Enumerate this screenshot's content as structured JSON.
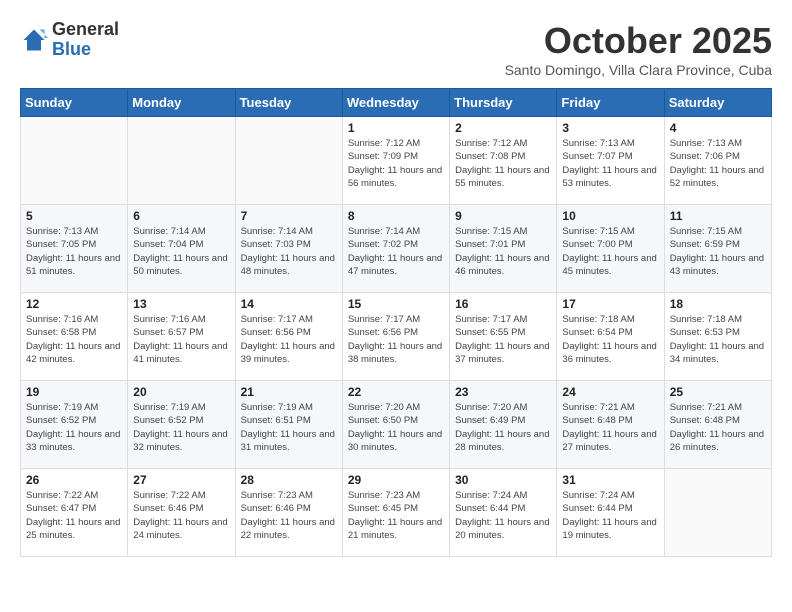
{
  "logo": {
    "general": "General",
    "blue": "Blue"
  },
  "title": {
    "month_year": "October 2025",
    "location": "Santo Domingo, Villa Clara Province, Cuba"
  },
  "days_of_week": [
    "Sunday",
    "Monday",
    "Tuesday",
    "Wednesday",
    "Thursday",
    "Friday",
    "Saturday"
  ],
  "weeks": [
    [
      {
        "day": "",
        "info": ""
      },
      {
        "day": "",
        "info": ""
      },
      {
        "day": "",
        "info": ""
      },
      {
        "day": "1",
        "info": "Sunrise: 7:12 AM\nSunset: 7:09 PM\nDaylight: 11 hours and 56 minutes."
      },
      {
        "day": "2",
        "info": "Sunrise: 7:12 AM\nSunset: 7:08 PM\nDaylight: 11 hours and 55 minutes."
      },
      {
        "day": "3",
        "info": "Sunrise: 7:13 AM\nSunset: 7:07 PM\nDaylight: 11 hours and 53 minutes."
      },
      {
        "day": "4",
        "info": "Sunrise: 7:13 AM\nSunset: 7:06 PM\nDaylight: 11 hours and 52 minutes."
      }
    ],
    [
      {
        "day": "5",
        "info": "Sunrise: 7:13 AM\nSunset: 7:05 PM\nDaylight: 11 hours and 51 minutes."
      },
      {
        "day": "6",
        "info": "Sunrise: 7:14 AM\nSunset: 7:04 PM\nDaylight: 11 hours and 50 minutes."
      },
      {
        "day": "7",
        "info": "Sunrise: 7:14 AM\nSunset: 7:03 PM\nDaylight: 11 hours and 48 minutes."
      },
      {
        "day": "8",
        "info": "Sunrise: 7:14 AM\nSunset: 7:02 PM\nDaylight: 11 hours and 47 minutes."
      },
      {
        "day": "9",
        "info": "Sunrise: 7:15 AM\nSunset: 7:01 PM\nDaylight: 11 hours and 46 minutes."
      },
      {
        "day": "10",
        "info": "Sunrise: 7:15 AM\nSunset: 7:00 PM\nDaylight: 11 hours and 45 minutes."
      },
      {
        "day": "11",
        "info": "Sunrise: 7:15 AM\nSunset: 6:59 PM\nDaylight: 11 hours and 43 minutes."
      }
    ],
    [
      {
        "day": "12",
        "info": "Sunrise: 7:16 AM\nSunset: 6:58 PM\nDaylight: 11 hours and 42 minutes."
      },
      {
        "day": "13",
        "info": "Sunrise: 7:16 AM\nSunset: 6:57 PM\nDaylight: 11 hours and 41 minutes."
      },
      {
        "day": "14",
        "info": "Sunrise: 7:17 AM\nSunset: 6:56 PM\nDaylight: 11 hours and 39 minutes."
      },
      {
        "day": "15",
        "info": "Sunrise: 7:17 AM\nSunset: 6:56 PM\nDaylight: 11 hours and 38 minutes."
      },
      {
        "day": "16",
        "info": "Sunrise: 7:17 AM\nSunset: 6:55 PM\nDaylight: 11 hours and 37 minutes."
      },
      {
        "day": "17",
        "info": "Sunrise: 7:18 AM\nSunset: 6:54 PM\nDaylight: 11 hours and 36 minutes."
      },
      {
        "day": "18",
        "info": "Sunrise: 7:18 AM\nSunset: 6:53 PM\nDaylight: 11 hours and 34 minutes."
      }
    ],
    [
      {
        "day": "19",
        "info": "Sunrise: 7:19 AM\nSunset: 6:52 PM\nDaylight: 11 hours and 33 minutes."
      },
      {
        "day": "20",
        "info": "Sunrise: 7:19 AM\nSunset: 6:52 PM\nDaylight: 11 hours and 32 minutes."
      },
      {
        "day": "21",
        "info": "Sunrise: 7:19 AM\nSunset: 6:51 PM\nDaylight: 11 hours and 31 minutes."
      },
      {
        "day": "22",
        "info": "Sunrise: 7:20 AM\nSunset: 6:50 PM\nDaylight: 11 hours and 30 minutes."
      },
      {
        "day": "23",
        "info": "Sunrise: 7:20 AM\nSunset: 6:49 PM\nDaylight: 11 hours and 28 minutes."
      },
      {
        "day": "24",
        "info": "Sunrise: 7:21 AM\nSunset: 6:48 PM\nDaylight: 11 hours and 27 minutes."
      },
      {
        "day": "25",
        "info": "Sunrise: 7:21 AM\nSunset: 6:48 PM\nDaylight: 11 hours and 26 minutes."
      }
    ],
    [
      {
        "day": "26",
        "info": "Sunrise: 7:22 AM\nSunset: 6:47 PM\nDaylight: 11 hours and 25 minutes."
      },
      {
        "day": "27",
        "info": "Sunrise: 7:22 AM\nSunset: 6:46 PM\nDaylight: 11 hours and 24 minutes."
      },
      {
        "day": "28",
        "info": "Sunrise: 7:23 AM\nSunset: 6:46 PM\nDaylight: 11 hours and 22 minutes."
      },
      {
        "day": "29",
        "info": "Sunrise: 7:23 AM\nSunset: 6:45 PM\nDaylight: 11 hours and 21 minutes."
      },
      {
        "day": "30",
        "info": "Sunrise: 7:24 AM\nSunset: 6:44 PM\nDaylight: 11 hours and 20 minutes."
      },
      {
        "day": "31",
        "info": "Sunrise: 7:24 AM\nSunset: 6:44 PM\nDaylight: 11 hours and 19 minutes."
      },
      {
        "day": "",
        "info": ""
      }
    ]
  ]
}
